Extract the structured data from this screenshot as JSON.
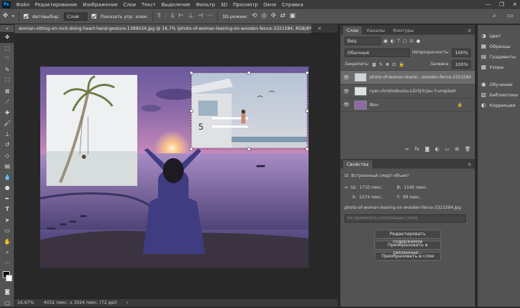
{
  "app": {
    "logo": "Ps"
  },
  "menu": [
    "Файл",
    "Редактирование",
    "Изображение",
    "Слои",
    "Текст",
    "Выделение",
    "Фильтр",
    "3D",
    "Просмотр",
    "Окно",
    "Справка"
  ],
  "window_controls": [
    "—",
    "❐",
    "✕"
  ],
  "options": {
    "autoselect_label": "Автовыбор:",
    "autoselect_value": "Слой",
    "show_controls_label": "Показать упр. элем.",
    "mode3d_label": "3D-режим:"
  },
  "document": {
    "tab_title": "woman-sitting-on-rock-doing-heart-hand-gesture-1399034.jpg @ 16,7% (photo-of-woman-leaning-on-wooden-fence-3321584, RGB/8*) *",
    "close": "×"
  },
  "status": {
    "zoom": "16,67%",
    "info": "4032 пикс. x 3024 пикс. (72 ppi)"
  },
  "layers_panel": {
    "tabs": [
      "Слои",
      "Каналы",
      "Контуры"
    ],
    "kind_select": "Вид",
    "blend_mode": "Обычные",
    "opacity_label": "Непрозрачность:",
    "opacity_value": "100%",
    "lock_label": "Закрепить:",
    "fill_label": "Заливка:",
    "fill_value": "100%",
    "layers": [
      {
        "name": "photo-of-woman-leanin...wooden-fence-3321584"
      },
      {
        "name": "ryan-christodoulou-LDr5J3cjau Y-unsplash"
      },
      {
        "name": "Фон"
      }
    ]
  },
  "properties": {
    "title": "Свойства",
    "type": "Встроенный смарт-объект",
    "w_label": "Ш:",
    "w_value": "1710 пикс.",
    "h_label": "В:",
    "h_value": "1140 пикс.",
    "x_label": "X:",
    "x_value": "2274 пикс.",
    "y_label": "Y:",
    "y_value": "99 пикс.",
    "filename": "photo-of-woman-leaning-on-wooden-fence-3321584.jpg",
    "comp_placeholder": "Не применять композиции слоев",
    "btn_edit": "Редактировать содержимое",
    "btn_convert_linked": "Преобразовать в связанные...",
    "btn_convert_layers": "Преобразовать в слои"
  },
  "dock": [
    {
      "label": "Цвет",
      "icon": "color-icon"
    },
    {
      "label": "Образцы",
      "icon": "swatches-icon"
    },
    {
      "label": "Градиенты",
      "icon": "gradients-icon"
    },
    {
      "label": "Узоры",
      "icon": "patterns-icon"
    },
    {
      "label": "Обучение",
      "icon": "learn-icon"
    },
    {
      "label": "Библиотеки",
      "icon": "libraries-icon"
    },
    {
      "label": "Коррекция",
      "icon": "adjustments-icon"
    }
  ],
  "colors": {
    "bg": "#282828",
    "panel": "#535353",
    "selected": "#6b6b6b"
  }
}
